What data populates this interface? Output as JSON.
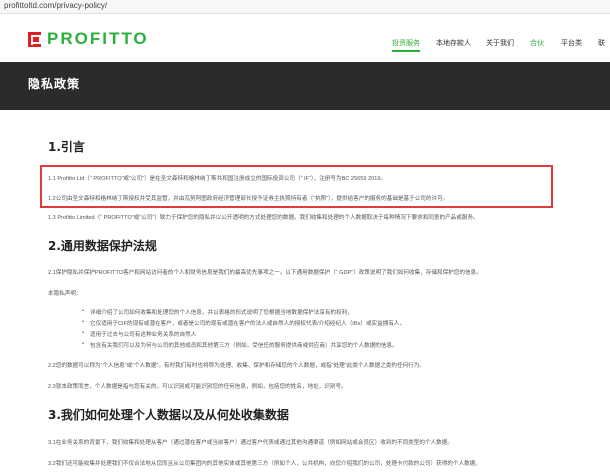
{
  "url": "profittoltd.com/privacy-policy/",
  "logo": {
    "text": "PROFITTO"
  },
  "nav": [
    {
      "label": "投资服务",
      "state": "active"
    },
    {
      "label": "本地存款人",
      "state": "normal"
    },
    {
      "label": "关于我们",
      "state": "normal"
    },
    {
      "label": "合伙",
      "state": "green"
    },
    {
      "label": "平台类",
      "state": "normal"
    },
    {
      "label": "联",
      "state": "normal"
    }
  ],
  "page_title": "隐私政策",
  "sections": {
    "s1": {
      "heading": "1.引言",
      "p1": "1.1 Profitto Ltd（“ PROFITTO”或“公司”）是在圣文森特和格林纳丁斯共和国注册成立的国际投资公司（“ IF”），注册号为BC 25659 2019。",
      "p2": "1.2公司由圣文森特和格林纳丁斯授权并受其监管，并由瓦努阿图政府经济管理部长授予证券主执照持有者（“执照”），提供给客户的服务的基础是基于公司的许可。",
      "p3": "1.3 Profitto Limited（“ PROFITTO”或“公司”）致力于保护您的隐私并以公开透明的方式处理您的数据。我们收集和处理的个人数据取决于每种情况下要求和同意的产品或服务。"
    },
    "s2": {
      "heading": "2.通用数据保护法规",
      "p1": "2.1保护隐私并保护PROFITTO客户和网站访问者的个人和财务信息是我们的最高优先事项之一。以下通用数据保护（“ GDP”）政策说明了我们如何收集，存储和保护您的信息。",
      "p2": "本隐私声明：",
      "bullets": [
        "详细介绍了公司如何收集和处理您的个人信息，并以表格的形式说明了您根据当地数据保护法享有的权利，",
        "它仅适用于CIF的现有或潜在客户，或者是公司的现有或潜在客户的法人或自然人的授权代表/介绍经纪人（IBs）或实益拥有人，",
        "适用于过去与公司有这种业务关系的自然人",
        "包含有关我们可以及为何与公司的其他成员和其他第三方（例如，受信任的服务提供商或供应商）共享您的个人数据的信息。"
      ],
      "p3": "2.2您的数据可以称为“个人信息”或“个人数据”。有时我们有时也将称为处理、收集、保护和存储您的个人数据，或指“处理”此类个人数据之类的任何行为。",
      "p4": "2.3就本政策而言，个人数据是指与您有关的，可以识别或可能识别您的任何信息，例如，包括您的姓名，地址，识别号。"
    },
    "s3": {
      "heading": "3.我们如何处理个人数据以及从何处收集数据",
      "p1": "3.1在业务关系的背景下，我们收集和处理从客户（通过潜在客户或当前客户）通过客户代表或通过其他沟通渠道（例如网站或会员区）收到的不同类型的个人数据。",
      "p2": "3.2我们还可能收集并处理我们不仅合法地从您而且从公司集团内的其他实体或其他第三方（例如个人，公共机构，向您介绍我们的公司，处理卡付款的公司）获得的个人数据。"
    }
  }
}
